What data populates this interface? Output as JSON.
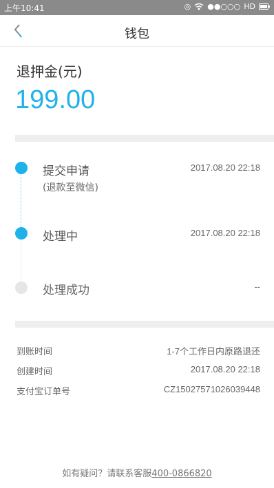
{
  "status_bar": {
    "time": "上午10:41",
    "icons": [
      "alarm-icon",
      "wifi-icon",
      "signal-icon",
      "battery-icon"
    ],
    "network": "HD"
  },
  "header": {
    "title": "钱包",
    "back_icon": "chevron-left-icon"
  },
  "amount": {
    "label": "退押金(元)",
    "value": "199.00",
    "color": "#1fb2ea"
  },
  "timeline": [
    {
      "title": "提交申请",
      "sub": "(退款至微信)",
      "time": "2017.08.20 22:18",
      "active": true
    },
    {
      "title": "处理中",
      "time": "2017.08.20 22:18",
      "active": true
    },
    {
      "title": "处理成功",
      "time": "--",
      "active": false
    }
  ],
  "details": [
    {
      "label": "到账时间",
      "value": "1-7个工作日内原路退还"
    },
    {
      "label": "创建时间",
      "value": "2017.08.20 22:18"
    },
    {
      "label": "支付宝订单号",
      "value": "CZ15027571026039448"
    }
  ],
  "footer": {
    "prompt": "如有疑问？请联系客服",
    "phone": "400-0866820"
  }
}
